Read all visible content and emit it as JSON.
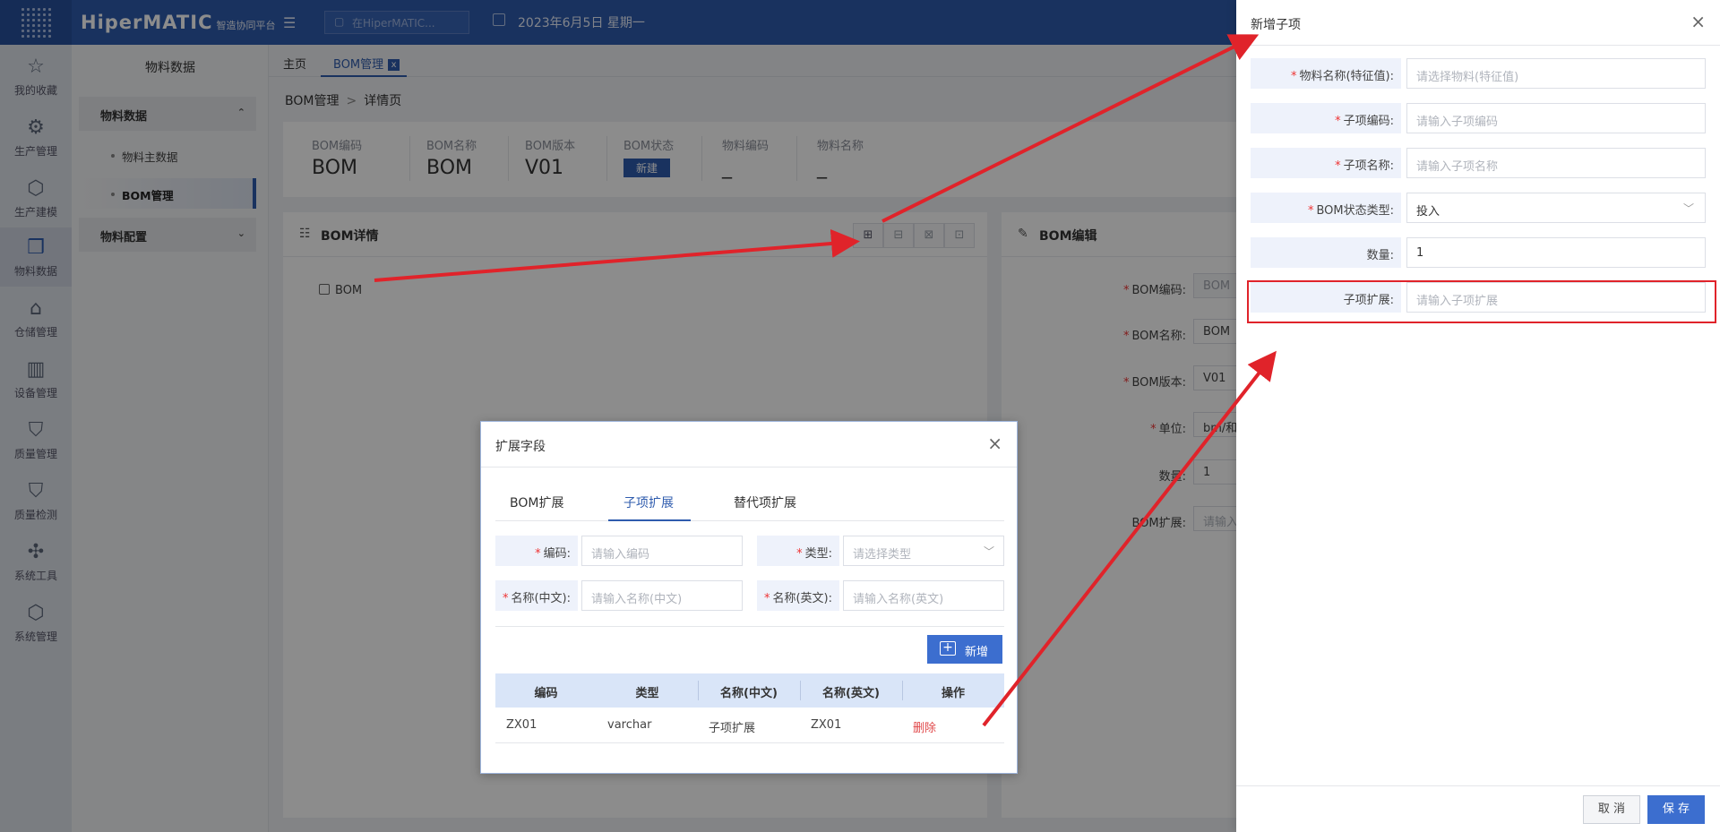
{
  "header": {
    "logo": "HiperMATIC",
    "logo_sub": "智造协同平台",
    "search_placeholder": "在HiperMATIC...",
    "date": "2023年6月5日 星期一"
  },
  "rail": [
    {
      "label": "我的收藏",
      "icon": "star-icon",
      "glyph": "☆"
    },
    {
      "label": "生产管理",
      "icon": "production-icon",
      "glyph": "⚙"
    },
    {
      "label": "生产建模",
      "icon": "cube-icon",
      "glyph": "⬡"
    },
    {
      "label": "物料数据",
      "icon": "material-icon",
      "glyph": "❒"
    },
    {
      "label": "仓储管理",
      "icon": "warehouse-icon",
      "glyph": "⌂"
    },
    {
      "label": "设备管理",
      "icon": "device-icon",
      "glyph": "▥"
    },
    {
      "label": "质量管理",
      "icon": "shield-icon",
      "glyph": "⛉"
    },
    {
      "label": "质量检测",
      "icon": "inspect-icon",
      "glyph": "⛉"
    },
    {
      "label": "系统工具",
      "icon": "network-icon",
      "glyph": "✣"
    },
    {
      "label": "系统管理",
      "icon": "settings-cube-icon",
      "glyph": "⬡"
    }
  ],
  "menu": {
    "title": "物料数据",
    "group1": "物料数据",
    "sub1": "物料主数据",
    "sub2": "BOM管理",
    "group2": "物料配置"
  },
  "tabs": {
    "home": "主页",
    "bom": "BOM管理",
    "close": "x"
  },
  "breadcrumb": {
    "root": "BOM管理",
    "sep": ">",
    "current": "详情页"
  },
  "summary": [
    {
      "label": "BOM编码",
      "value": "BOM"
    },
    {
      "label": "BOM名称",
      "value": "BOM"
    },
    {
      "label": "BOM版本",
      "value": "V01"
    },
    {
      "label": "BOM状态",
      "badge": "新建"
    },
    {
      "label": "物料编码",
      "value": "_"
    },
    {
      "label": "物料名称",
      "value": "_"
    }
  ],
  "detail": {
    "title": "BOM详情",
    "tree_root": "BOM"
  },
  "edit": {
    "title": "BOM编辑",
    "fields": [
      {
        "label": "BOM编码:",
        "value": "BOM",
        "required": "*"
      },
      {
        "label": "BOM名称:",
        "value": "BOM",
        "required": "*"
      },
      {
        "label": "BOM版本:",
        "value": "V01",
        "required": "*"
      },
      {
        "label": "单位:",
        "value": "bm/和",
        "required": "*"
      },
      {
        "label": "数量:",
        "value": "1",
        "required": ""
      },
      {
        "label": "BOM扩展:",
        "value": "请输入",
        "required": ""
      }
    ]
  },
  "modal": {
    "title": "扩展字段",
    "close": "×",
    "tabs": [
      "BOM扩展",
      "子项扩展",
      "替代项扩展"
    ],
    "fields": {
      "code_label": "编码:",
      "code_placeholder": "请输入编码",
      "type_label": "类型:",
      "type_placeholder": "请选择类型",
      "name_cn_label": "名称(中文):",
      "name_cn_placeholder": "请输入名称(中文)",
      "name_en_label": "名称(英文):",
      "name_en_placeholder": "请输入名称(英文)",
      "required": "*"
    },
    "add_button": "新增",
    "table": {
      "headers": [
        "编码",
        "类型",
        "名称(中文)",
        "名称(英文)",
        "操作"
      ],
      "row": [
        "ZX01",
        "varchar",
        "子项扩展",
        "ZX01",
        "删除"
      ]
    }
  },
  "drawer": {
    "title": "新增子项",
    "close": "×",
    "fields": [
      {
        "label": "物料名称(特征值):",
        "value": "请选择物料(特征值)",
        "required": "*",
        "filled": false
      },
      {
        "label": "子项编码:",
        "value": "请输入子项编码",
        "required": "*",
        "filled": false
      },
      {
        "label": "子项名称:",
        "value": "请输入子项名称",
        "required": "*",
        "filled": false
      },
      {
        "label": "BOM状态类型:",
        "value": "投入",
        "required": "*",
        "filled": true
      },
      {
        "label": "数量:",
        "value": "1",
        "required": "",
        "filled": true
      },
      {
        "label": "子项扩展:",
        "value": "请输入子项扩展",
        "required": "",
        "filled": false
      }
    ],
    "cancel": "取 消",
    "save": "保 存"
  },
  "colors": {
    "primary": "#2f5cae",
    "button": "#3c6ecf",
    "annotation_red": "#e0232a",
    "danger": "#e0484a"
  }
}
